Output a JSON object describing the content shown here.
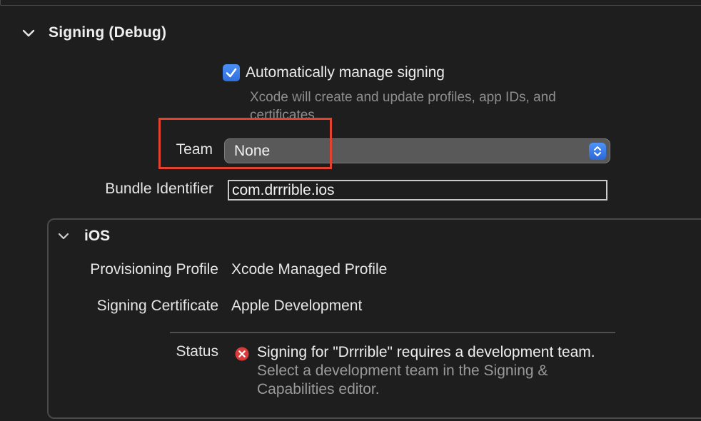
{
  "section": {
    "title": "Signing (Debug)"
  },
  "auto_signing": {
    "label": "Automatically manage signing",
    "checked": true,
    "help": "Xcode will create and update profiles, app IDs, and certificates."
  },
  "team": {
    "label": "Team",
    "value": "None"
  },
  "bundle": {
    "label": "Bundle Identifier",
    "value": "com.drrrible.ios"
  },
  "ios": {
    "title": "iOS",
    "provisioning_label": "Provisioning Profile",
    "provisioning_value": "Xcode Managed Profile",
    "certificate_label": "Signing Certificate",
    "certificate_value": "Apple Development",
    "status_label": "Status",
    "status_message": "Signing for \"Drrrible\" requires a development team.",
    "status_help": " Select a development team in the Signing & Capabilities editor."
  },
  "colors": {
    "accent": "#3b82f6",
    "highlight": "#e2432e",
    "error": "#d93b3b"
  }
}
